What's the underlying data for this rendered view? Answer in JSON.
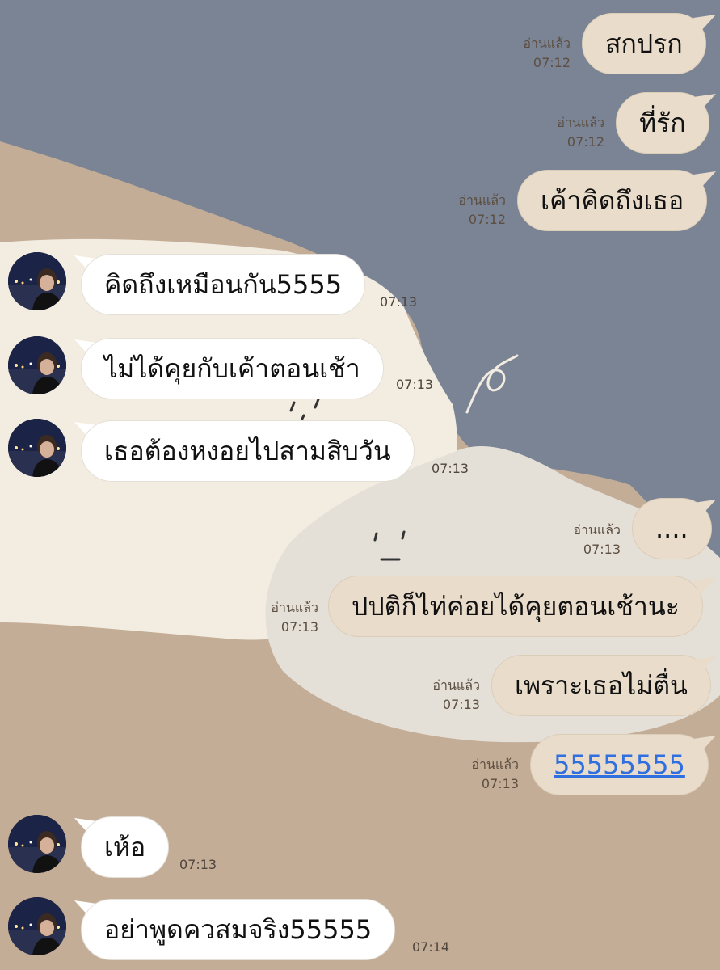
{
  "chat": {
    "read_label": "อ่านแล้ว",
    "messages": [
      {
        "side": "sent",
        "text": "สกปรก",
        "read": "อ่านแล้ว",
        "time": "07:12"
      },
      {
        "side": "sent",
        "text": "ที่รัก",
        "read": "อ่านแล้ว",
        "time": "07:12"
      },
      {
        "side": "sent",
        "text": "เค้าคิดถึงเธอ",
        "read": "อ่านแล้ว",
        "time": "07:12"
      },
      {
        "side": "received",
        "text": "คิดถึงเหมือนกัน5555",
        "time": "07:13"
      },
      {
        "side": "received",
        "text": "ไม่ได้คุยกับเค้าตอนเช้า",
        "time": "07:13"
      },
      {
        "side": "received",
        "text": "เธอต้องหงอยไปสามสิบวัน",
        "time": "07:13"
      },
      {
        "side": "sent",
        "text": "....",
        "read": "อ่านแล้ว",
        "time": "07:13"
      },
      {
        "side": "sent",
        "text": "ปปติก็ไท่ค่อยได้คุยตอนเช้านะ",
        "read": "อ่านแล้ว",
        "time": "07:13"
      },
      {
        "side": "sent",
        "text": "เพราะเธอไม่ตื่น",
        "read": "อ่านแล้ว",
        "time": "07:13"
      },
      {
        "side": "sent",
        "text": "55555555",
        "read": "อ่านแล้ว",
        "time": "07:13",
        "is_link": true
      },
      {
        "side": "received",
        "text": "เห้อ",
        "time": "07:13"
      },
      {
        "side": "received",
        "text": "อย่าพูดควสมจริง55555",
        "time": "07:14"
      }
    ]
  },
  "colors": {
    "background_slate": "#7a8495",
    "background_tan": "#c4ad96",
    "blob_cream": "#f3ece1",
    "blob_grey": "#e4e0d8",
    "sent_bubble": "#e9dccb",
    "received_bubble": "#ffffff",
    "link": "#2f6fe0"
  },
  "decorations": [
    "squiggle-doodle",
    "surprised-face-doodle",
    "blush-marks-doodle"
  ]
}
